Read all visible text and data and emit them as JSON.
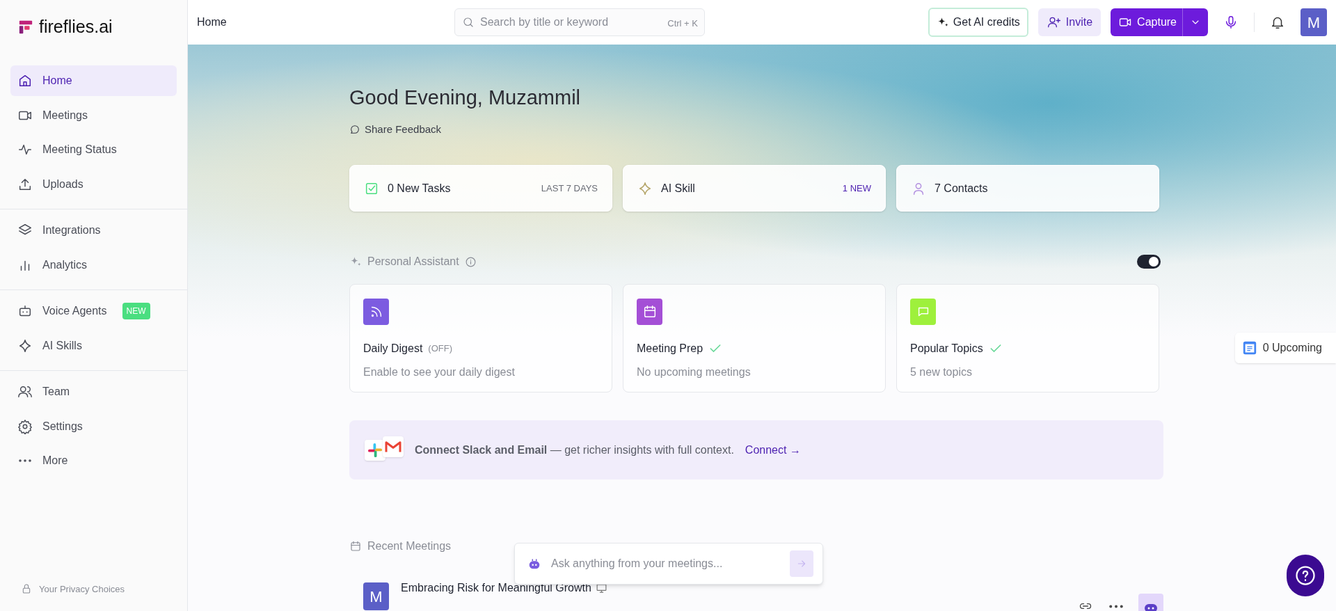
{
  "brand": {
    "name": "fireflies.ai"
  },
  "sidebar": {
    "groups": [
      [
        {
          "label": "Home",
          "selected": true
        },
        {
          "label": "Meetings",
          "selected": false
        },
        {
          "label": "Meeting Status",
          "selected": false
        },
        {
          "label": "Uploads",
          "selected": false
        }
      ],
      [
        {
          "label": "Integrations",
          "selected": false
        },
        {
          "label": "Analytics",
          "selected": false
        }
      ],
      [
        {
          "label": "Voice Agents",
          "selected": false,
          "badge": "NEW"
        },
        {
          "label": "AI Skills",
          "selected": false
        }
      ],
      [
        {
          "label": "Team",
          "selected": false
        },
        {
          "label": "Settings",
          "selected": false
        },
        {
          "label": "More",
          "selected": false
        }
      ]
    ],
    "footer": "Your Privacy Choices"
  },
  "topbar": {
    "title": "Home",
    "search": {
      "placeholder": "Search by title or keyword",
      "shortcut": "Ctrl + K"
    },
    "credits_button": "Get AI credits",
    "invite_button": "Invite",
    "capture_button": "Capture",
    "avatar": "M"
  },
  "greeting": "Good Evening, Muzammil",
  "feedback_link": "Share Feedback",
  "stats": [
    {
      "label": "0 New Tasks",
      "tag": "LAST 7 DAYS",
      "highlight": false
    },
    {
      "label": "AI Skill",
      "tag": "1 NEW",
      "highlight": true
    },
    {
      "label": "7 Contacts"
    }
  ],
  "assistant": {
    "title": "Personal Assistant",
    "on": true,
    "cards": [
      {
        "color": "#7c5ce0",
        "title": "Daily Digest",
        "status": "(OFF)",
        "checked": false,
        "subtitle": "Enable to see your daily digest"
      },
      {
        "color": "#a44fd6",
        "title": "Meeting Prep",
        "checked": true,
        "subtitle": "No upcoming meetings"
      },
      {
        "color": "#9ef03c",
        "title": "Popular Topics",
        "checked": true,
        "subtitle": "5 new topics"
      }
    ]
  },
  "banner": {
    "text": "**Connect Slack and Email** — get richer insights with full context.",
    "link": "Connect →"
  },
  "recent": {
    "title": "Recent Meetings",
    "meetings": [
      {
        "avatar": "M",
        "title": "Embracing Risk for Meaningful Growth"
      }
    ]
  },
  "ask": {
    "placeholder": "Ask anything from your meetings..."
  },
  "upcoming": "0 Upcoming"
}
